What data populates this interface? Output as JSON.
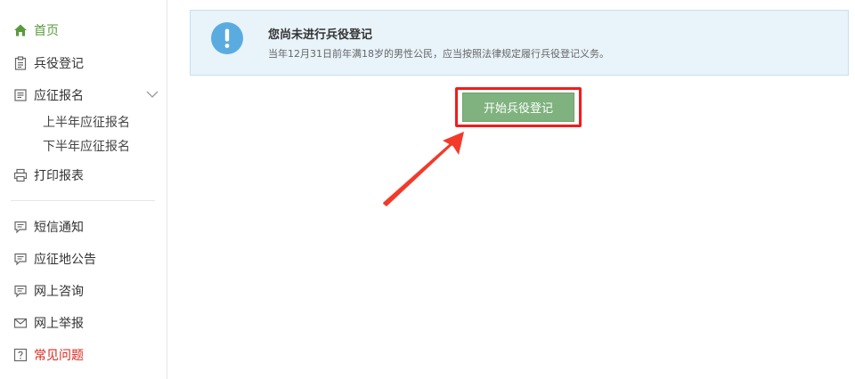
{
  "sidebar": {
    "items": [
      {
        "label": "首页",
        "icon": "home-icon"
      },
      {
        "label": "兵役登记",
        "icon": "clipboard-icon"
      },
      {
        "label": "应征报名",
        "icon": "document-icon",
        "expanded": true
      },
      {
        "label": "打印报表",
        "icon": "printer-icon"
      },
      {
        "label": "短信通知",
        "icon": "message-icon"
      },
      {
        "label": "应征地公告",
        "icon": "message-icon"
      },
      {
        "label": "网上咨询",
        "icon": "message-icon"
      },
      {
        "label": "网上举报",
        "icon": "mail-icon"
      },
      {
        "label": "常见问题",
        "icon": "question-icon"
      }
    ],
    "subitems": [
      {
        "label": "上半年应征报名"
      },
      {
        "label": "下半年应征报名"
      }
    ]
  },
  "notice": {
    "title": "您尚未进行兵役登记",
    "description": "当年12月31日前年满18岁的男性公民，应当按照法律规定履行兵役登记义务。",
    "icon": "info-exclamation-icon"
  },
  "main": {
    "start_button_label": "开始兵役登记"
  },
  "colors": {
    "accent_green": "#5a9a3f",
    "button_green": "#7fb27e",
    "highlight_red": "#f31b1b",
    "notice_bg": "#e8f3fa",
    "faq_red": "#d9281f"
  }
}
